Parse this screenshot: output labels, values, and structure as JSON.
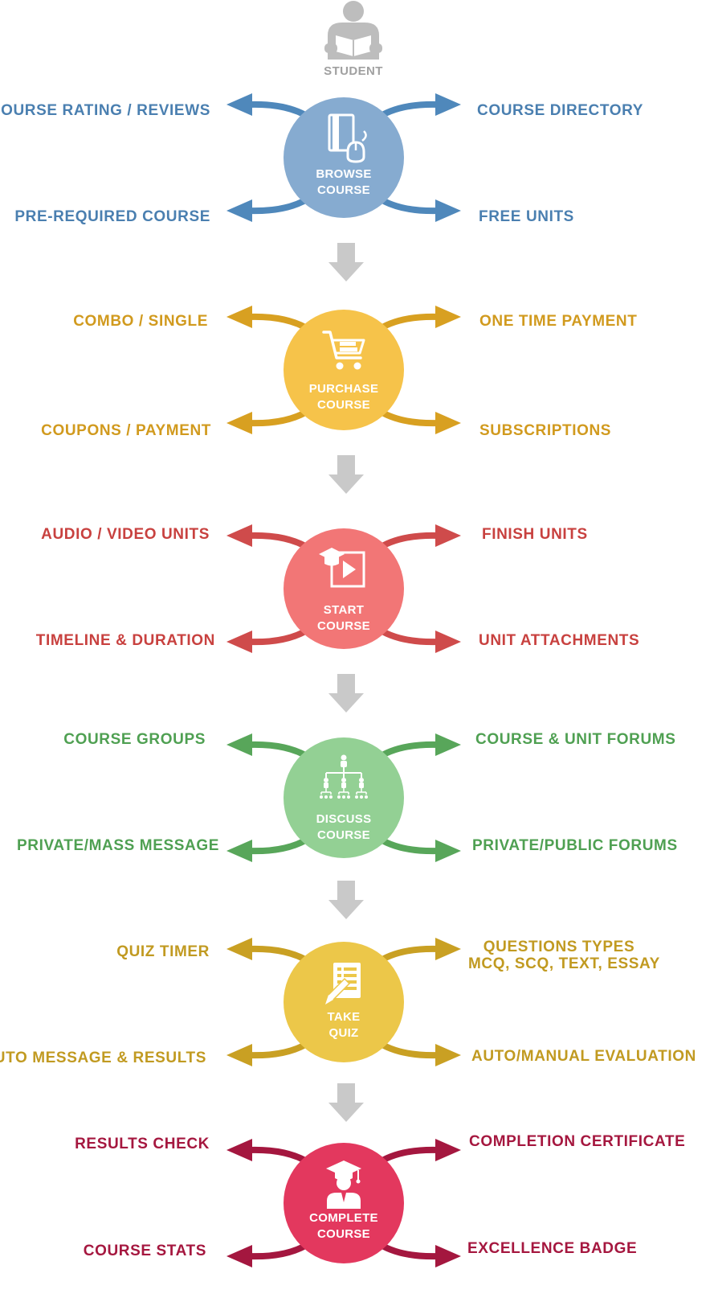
{
  "student": {
    "label": "STUDENT",
    "icon": "student-reading-icon",
    "color": "#b8b8b8"
  },
  "connector": {
    "icon": "down-arrow-icon",
    "color": "#c9c9c9"
  },
  "stages": [
    {
      "id": "browse",
      "line1": "BROWSE",
      "line2": "COURSE",
      "icon": "book-mouse-icon",
      "circle_color": "#86abd0",
      "arrow_color": "#4f88bb",
      "text_color": "#4a7fb0",
      "top_left": "COURSE RATING / REVIEWS",
      "top_right": "COURSE DIRECTORY",
      "bottom_left": "PRE-REQUIRED COURSE",
      "bottom_right": "FREE UNITS"
    },
    {
      "id": "purchase",
      "line1": "PURCHASE",
      "line2": "COURSE",
      "icon": "shopping-cart-icon",
      "circle_color": "#f6c34a",
      "arrow_color": "#d8a021",
      "text_color": "#d19a1e",
      "top_left": "COMBO / SINGLE",
      "top_right": "ONE TIME PAYMENT",
      "bottom_left": "COUPONS / PAYMENT",
      "bottom_right": "SUBSCRIPTIONS"
    },
    {
      "id": "start",
      "line1": "START",
      "line2": "COURSE",
      "icon": "video-play-icon",
      "circle_color": "#f27676",
      "arrow_color": "#cf4b4b",
      "text_color": "#c8413f",
      "top_left": "AUDIO / VIDEO UNITS",
      "top_right": "FINISH UNITS",
      "bottom_left": "TIMELINE & DURATION",
      "bottom_right": "UNIT ATTACHMENTS"
    },
    {
      "id": "discuss",
      "line1": "DISCUSS",
      "line2": "COURSE",
      "icon": "org-chart-icon",
      "circle_color": "#93d094",
      "arrow_color": "#58a65a",
      "text_color": "#4fa052",
      "top_left": "COURSE GROUPS",
      "top_right": "COURSE & UNIT FORUMS",
      "bottom_left": "PRIVATE/MASS MESSAGE",
      "bottom_right": "PRIVATE/PUBLIC FORUMS"
    },
    {
      "id": "quiz",
      "line1": "TAKE",
      "line2": "QUIZ",
      "icon": "quiz-paper-pencil-icon",
      "circle_color": "#ecc749",
      "arrow_color": "#c9a023",
      "text_color": "#c19a21",
      "top_left": "QUIZ TIMER",
      "top_right": "QUESTIONS TYPES",
      "top_right_2": "MCQ, SCQ, TEXT, ESSAY",
      "bottom_left": "AUTO MESSAGE & RESULTS",
      "bottom_right": "AUTO/MANUAL EVALUATION"
    },
    {
      "id": "complete",
      "line1": "COMPLETE",
      "line2": "COURSE",
      "icon": "graduate-icon",
      "circle_color": "#e3385e",
      "arrow_color": "#a4173f",
      "text_color": "#a5173f",
      "top_left": "RESULTS CHECK",
      "top_right": "COMPLETION CERTIFICATE",
      "bottom_left": "COURSE STATS",
      "bottom_right": "EXCELLENCE BADGE"
    }
  ]
}
